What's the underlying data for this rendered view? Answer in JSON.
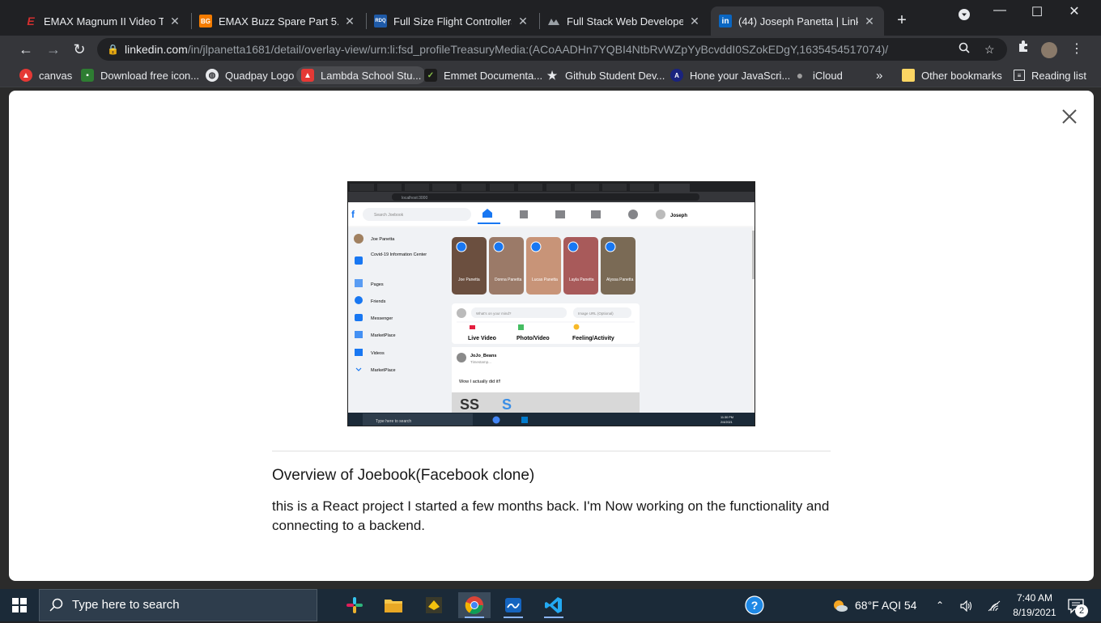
{
  "browser": {
    "tabs": [
      {
        "title": "EMAX Magnum II Video Tran",
        "favicon_color": "#d32f2f",
        "favicon_glyph": "E"
      },
      {
        "title": "EMAX Buzz Spare Part 5.8G",
        "favicon_color": "#f57c00",
        "favicon_glyph": "BG"
      },
      {
        "title": "Full Size Flight Controllers (3",
        "favicon_color": "#1e5aa8",
        "favicon_glyph": "RDQ"
      },
      {
        "title": "Full Stack Web Developer",
        "favicon_color": "#202124",
        "favicon_glyph": ""
      },
      {
        "title": "(44) Joseph Panetta | Linked",
        "favicon_color": "#0a66c2",
        "favicon_glyph": "in"
      }
    ],
    "url_host": "linkedin.com",
    "url_path": "/in/jlpanetta1681/detail/overlay-view/urn:li:fsd_profileTreasuryMedia:(ACoAADHn7YQBI4NtbRvWZpYyBcvddI0SZokEDgY,1635454517074)/",
    "bookmarks": [
      {
        "label": "canvas",
        "color": "#e53935",
        "glyph": "▲"
      },
      {
        "label": "Download free icon...",
        "color": "#2e7d32",
        "glyph": "▪"
      },
      {
        "label": "Quadpay Logo",
        "color": "#5f6368",
        "glyph": "◍"
      },
      {
        "label": "Lambda School Stu...",
        "color": "#e53935",
        "glyph": "▲"
      },
      {
        "label": "Emmet Documenta...",
        "color": "#8bc34a",
        "glyph": "✓"
      },
      {
        "label": "Github Student Dev...",
        "color": "#202124",
        "glyph": "★"
      },
      {
        "label": "Hone your JavaScri...",
        "color": "#1a237e",
        "glyph": "A"
      },
      {
        "label": "iCloud",
        "color": "#9e9e9e",
        "glyph": "●"
      }
    ],
    "bookmarks_overflow": "»",
    "other_bookmarks": "Other bookmarks",
    "reading_list": "Reading list"
  },
  "modal": {
    "title": "Overview of Joebook(Facebook clone)",
    "description": "this is a React project I started a few months back. I'm Now working on the functionality and connecting to a backend.",
    "embedded_screenshot": {
      "search_placeholder": "Search Joebook",
      "address": "localhost:3000",
      "user_name": "Joseph",
      "sidebar": [
        "Joe Panetta",
        "Covid-19 Information Center",
        "Pages",
        "Friends",
        "Messenger",
        "MarketPlace",
        "Videos",
        "MarketPlace"
      ],
      "stories": [
        "Joe Panetta",
        "Donna Panetta",
        "Lucas Panetta",
        "Layla Panetta",
        "Alyssa Panetta"
      ],
      "post_placeholder": "What's on your mind?",
      "image_placeholder": "Image URL (Optional)",
      "actions": [
        "Live Video",
        "Photo/Video",
        "Feeling/Activity"
      ],
      "post_author": "JoJo_Beans",
      "post_timestamp": "Timestamp...",
      "post_text": "Wow I actually did it!!",
      "taskbar_search": "Type here to search",
      "clock_time": "11:30 PM",
      "clock_date": "2/4/2021"
    }
  },
  "taskbar": {
    "search_placeholder": "Type here to search",
    "weather": "68°F  AQI 54",
    "time": "7:40 AM",
    "date": "8/19/2021",
    "notification_count": "2"
  }
}
